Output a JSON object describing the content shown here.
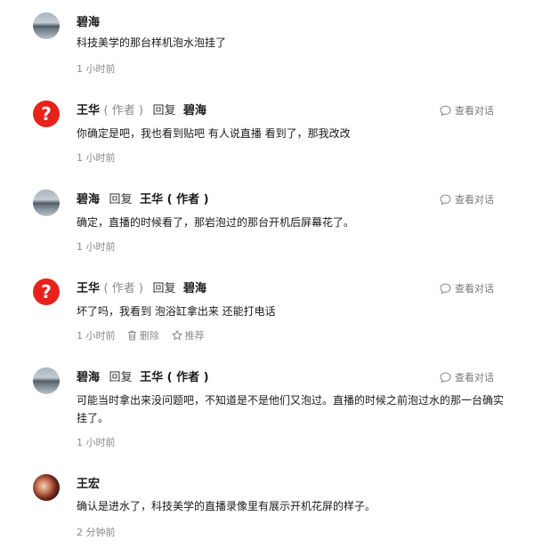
{
  "comments": [
    {
      "user": "碧海",
      "author_tag": "",
      "reply_label": "",
      "reply_to": "",
      "text": "科技美学的那台样机泡水泡挂了",
      "time": "1 小时前",
      "view": "",
      "avatar": "lake"
    },
    {
      "user": "王华",
      "author_tag": "( 作者 )",
      "reply_label": "回复",
      "reply_to": "碧海",
      "text": "你确定是吧，我也看到贴吧 有人说直播 看到了，那我改改",
      "time": "1 小时前",
      "view": "查看对话",
      "avatar": "question"
    },
    {
      "user": "碧海",
      "author_tag": "",
      "reply_label": "回复",
      "reply_to": "王华 ( 作者 )",
      "text": "确定，直播的时候看了，那岩泡过的那台开机后屏幕花了。",
      "time": "1 小时前",
      "view": "查看对话",
      "avatar": "lake"
    },
    {
      "user": "王华",
      "author_tag": "( 作者 )",
      "reply_label": "回复",
      "reply_to": "碧海",
      "text": "坏了吗，我看到 泡浴缸拿出来 还能打电话",
      "time": "1 小时前",
      "view": "查看对话",
      "avatar": "question",
      "actions": {
        "delete": "删除",
        "recommend": "推荐"
      }
    },
    {
      "user": "碧海",
      "author_tag": "",
      "reply_label": "回复",
      "reply_to": "王华 ( 作者 )",
      "text": "可能当时拿出来没问题吧，不知道是不是他们又泡过。直播的时候之前泡过水的那一台确实挂了。",
      "time": "1 小时前",
      "view": "查看对话",
      "avatar": "lake"
    },
    {
      "user": "王宏",
      "author_tag": "",
      "reply_label": "",
      "reply_to": "",
      "text": "确认是进水了，科技美学的直播录像里有展示开机花屏的样子。",
      "time": "2 分钟前",
      "view": "",
      "avatar": "red"
    }
  ]
}
